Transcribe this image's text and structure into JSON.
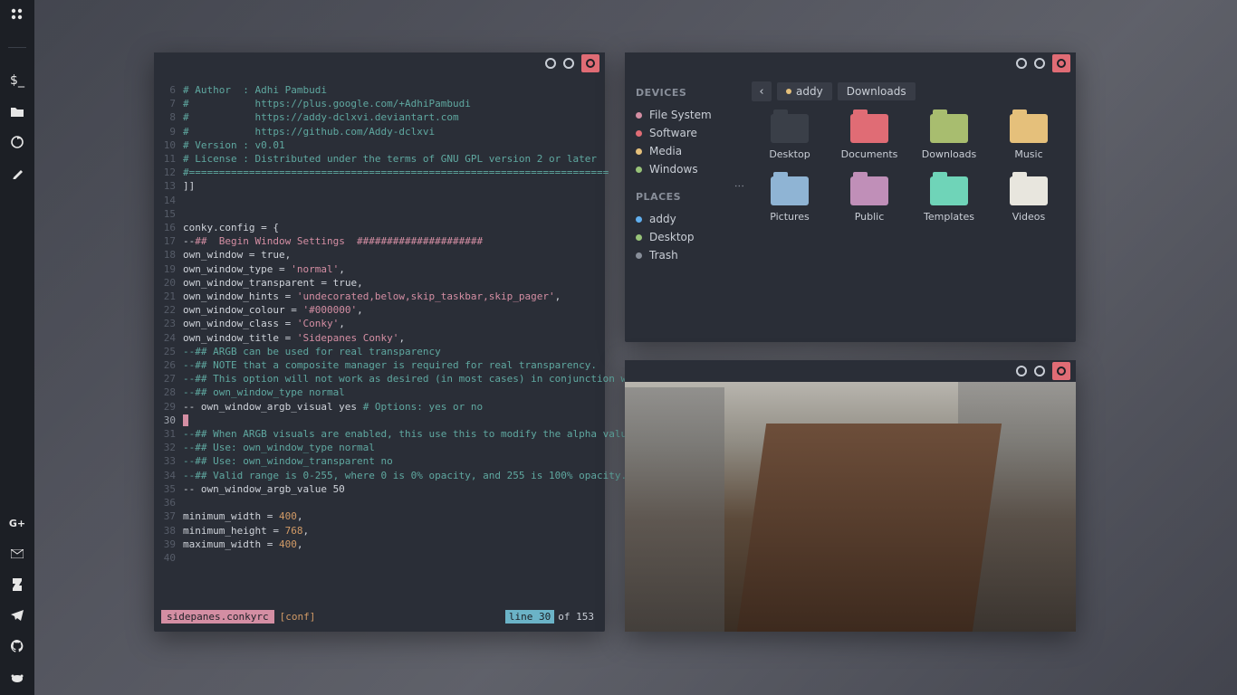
{
  "dock": {
    "top_icons": [
      "apps",
      "terminal",
      "files",
      "firefox",
      "pen"
    ],
    "bottom_icons": [
      "googleplus",
      "gmail",
      "deviantart",
      "telegram",
      "github",
      "reddit"
    ]
  },
  "editor": {
    "lines": [
      {
        "n": 6,
        "segs": [
          [
            "comment",
            "# Author  : Adhi Pambudi"
          ]
        ]
      },
      {
        "n": 7,
        "segs": [
          [
            "comment",
            "#           https://plus.google.com/+AdhiPambudi"
          ]
        ]
      },
      {
        "n": 8,
        "segs": [
          [
            "comment",
            "#           https://addy-dclxvi.deviantart.com"
          ]
        ]
      },
      {
        "n": 9,
        "segs": [
          [
            "comment",
            "#           https://github.com/Addy-dclxvi"
          ]
        ]
      },
      {
        "n": 10,
        "segs": [
          [
            "comment",
            "# Version : v0.01"
          ]
        ]
      },
      {
        "n": 11,
        "segs": [
          [
            "comment",
            "# License : Distributed under the terms of GNU GPL version 2 or later"
          ]
        ]
      },
      {
        "n": 12,
        "segs": [
          [
            "comment",
            "#======================================================================"
          ]
        ]
      },
      {
        "n": 13,
        "segs": [
          [
            "key",
            "]]"
          ]
        ]
      },
      {
        "n": 14,
        "segs": []
      },
      {
        "n": 15,
        "segs": []
      },
      {
        "n": 16,
        "segs": [
          [
            "key",
            "conky.config = {"
          ]
        ]
      },
      {
        "n": 17,
        "segs": [
          [
            "key",
            "--"
          ],
          [
            "sec",
            "##  Begin Window Settings  #####################"
          ]
        ]
      },
      {
        "n": 18,
        "segs": [
          [
            "key",
            "own_window "
          ],
          [
            "eq",
            "= "
          ],
          [
            "key",
            "true,"
          ]
        ]
      },
      {
        "n": 19,
        "segs": [
          [
            "key",
            "own_window_type "
          ],
          [
            "eq",
            "= "
          ],
          [
            "str",
            "'normal'"
          ],
          [
            "key",
            ","
          ]
        ]
      },
      {
        "n": 20,
        "segs": [
          [
            "key",
            "own_window_transparent "
          ],
          [
            "eq",
            "= "
          ],
          [
            "key",
            "true,"
          ]
        ]
      },
      {
        "n": 21,
        "segs": [
          [
            "key",
            "own_window_hints "
          ],
          [
            "eq",
            "= "
          ],
          [
            "str",
            "'undecorated,below,skip_taskbar,skip_pager'"
          ],
          [
            "key",
            ","
          ]
        ]
      },
      {
        "n": 22,
        "segs": [
          [
            "key",
            "own_window_colour "
          ],
          [
            "eq",
            "= "
          ],
          [
            "str",
            "'#000000'"
          ],
          [
            "key",
            ","
          ]
        ]
      },
      {
        "n": 23,
        "segs": [
          [
            "key",
            "own_window_class "
          ],
          [
            "eq",
            "= "
          ],
          [
            "str",
            "'Conky'"
          ],
          [
            "key",
            ","
          ]
        ]
      },
      {
        "n": 24,
        "segs": [
          [
            "key",
            "own_window_title "
          ],
          [
            "eq",
            "= "
          ],
          [
            "str",
            "'Sidepanes Conky'"
          ],
          [
            "key",
            ","
          ]
        ]
      },
      {
        "n": 25,
        "segs": [
          [
            "comment",
            "--## ARGB can be used for real transparency"
          ]
        ]
      },
      {
        "n": 26,
        "segs": [
          [
            "comment",
            "--## NOTE that a composite manager is required for real transparency."
          ]
        ]
      },
      {
        "n": 27,
        "segs": [
          [
            "comment",
            "--## This option will not work as desired (in most cases) in conjunction with"
          ]
        ]
      },
      {
        "n": 28,
        "segs": [
          [
            "comment",
            "--## own_window_type normal"
          ]
        ]
      },
      {
        "n": 29,
        "segs": [
          [
            "key",
            "-- own_window_argb_visual yes "
          ],
          [
            "comment",
            "# Options: yes or no"
          ]
        ]
      },
      {
        "n": 30,
        "current": true,
        "segs": [
          [
            "cursor",
            ""
          ]
        ]
      },
      {
        "n": 31,
        "segs": [
          [
            "comment",
            "--## When ARGB visuals are enabled, this use this to modify the alpha value"
          ]
        ]
      },
      {
        "n": 32,
        "segs": [
          [
            "comment",
            "--## Use: own_window_type normal"
          ]
        ]
      },
      {
        "n": 33,
        "segs": [
          [
            "comment",
            "--## Use: own_window_transparent no"
          ]
        ]
      },
      {
        "n": 34,
        "segs": [
          [
            "comment",
            "--## Valid range is 0-255, where 0 is 0% opacity, and 255 is 100% opacity."
          ]
        ]
      },
      {
        "n": 35,
        "segs": [
          [
            "key",
            "-- own_window_argb_value 50"
          ]
        ]
      },
      {
        "n": 36,
        "segs": []
      },
      {
        "n": 37,
        "segs": [
          [
            "key",
            "minimum_width "
          ],
          [
            "eq",
            "= "
          ],
          [
            "num",
            "400"
          ],
          [
            "key",
            ","
          ]
        ]
      },
      {
        "n": 38,
        "segs": [
          [
            "key",
            "minimum_height "
          ],
          [
            "eq",
            "= "
          ],
          [
            "num",
            "768"
          ],
          [
            "key",
            ","
          ]
        ]
      },
      {
        "n": 39,
        "segs": [
          [
            "key",
            "maximum_width "
          ],
          [
            "eq",
            "= "
          ],
          [
            "num",
            "400"
          ],
          [
            "key",
            ","
          ]
        ]
      },
      {
        "n": 40,
        "segs": []
      }
    ],
    "status": {
      "filename": "sidepanes.conkyrc",
      "filetype": "[conf]",
      "line_label": "line",
      "line_num": "30",
      "of": "of",
      "total": "153"
    }
  },
  "filemanager": {
    "devices_heading": "DEVICES",
    "places_heading": "PLACES",
    "devices": [
      {
        "label": "File System",
        "color": "#d48ea3"
      },
      {
        "label": "Software",
        "color": "#e06c75"
      },
      {
        "label": "Media",
        "color": "#e5c07b"
      },
      {
        "label": "Windows",
        "color": "#98c379"
      }
    ],
    "places": [
      {
        "label": "addy",
        "color": "#61afef"
      },
      {
        "label": "Desktop",
        "color": "#98c379"
      },
      {
        "label": "Trash",
        "color": "#888e99"
      }
    ],
    "path": [
      "addy",
      "Downloads"
    ],
    "folders": [
      {
        "label": "Desktop",
        "color": "#3a3f48"
      },
      {
        "label": "Documents",
        "color": "#e06c75"
      },
      {
        "label": "Downloads",
        "color": "#a8bd6f"
      },
      {
        "label": "Music",
        "color": "#e5c07b"
      },
      {
        "label": "Pictures",
        "color": "#8fb4d4"
      },
      {
        "label": "Public",
        "color": "#c08fb8"
      },
      {
        "label": "Templates",
        "color": "#6fd4b8"
      },
      {
        "label": "Videos",
        "color": "#e8e6de"
      }
    ]
  }
}
